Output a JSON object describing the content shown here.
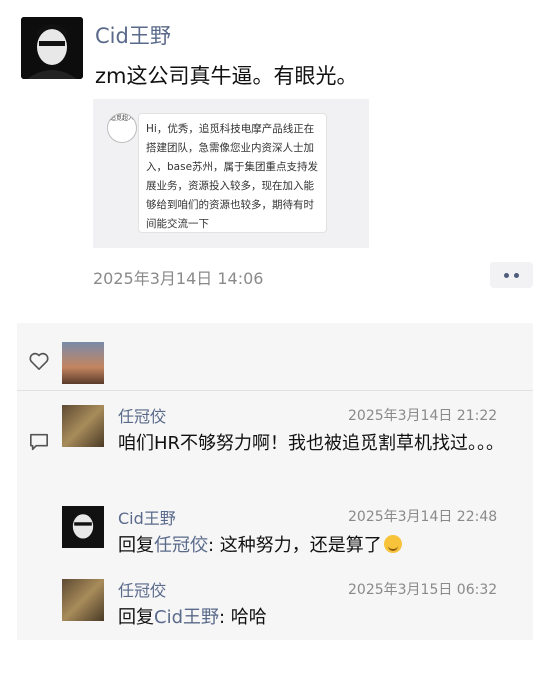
{
  "post": {
    "author": "Cid王野",
    "text": "zm这公司真牛逼。有眼光。",
    "card": {
      "logo_text": "追觅超人",
      "message": "Hi，优秀，追觅科技电摩产品线正在搭建团队，急需像您业内资深人士加入，base苏州，属于集团重点支持发展业务，资源投入较多，现在加入能够给到咱们的资源也较多，期待有时间能交流一下"
    },
    "time": "2025年3月14日 14:06"
  },
  "comments": [
    {
      "name": "任冠佼",
      "time": "2025年3月14日 21:22",
      "text": "咱们HR不够努力啊！我也被追觅割草机找过。。。"
    },
    {
      "name": "Cid王野",
      "time": "2025年3月14日 22:48",
      "reply_prefix": "回复",
      "reply_to": "任冠佼",
      "text": ": 这种努力，还是算了"
    },
    {
      "name": "任冠佼",
      "time": "2025年3月15日 06:32",
      "reply_prefix": "回复",
      "reply_to": "Cid王野",
      "text": ": 哈哈"
    }
  ],
  "colors": {
    "name_link": "#5a6a8a",
    "panel_bg": "#f6f6f7"
  }
}
